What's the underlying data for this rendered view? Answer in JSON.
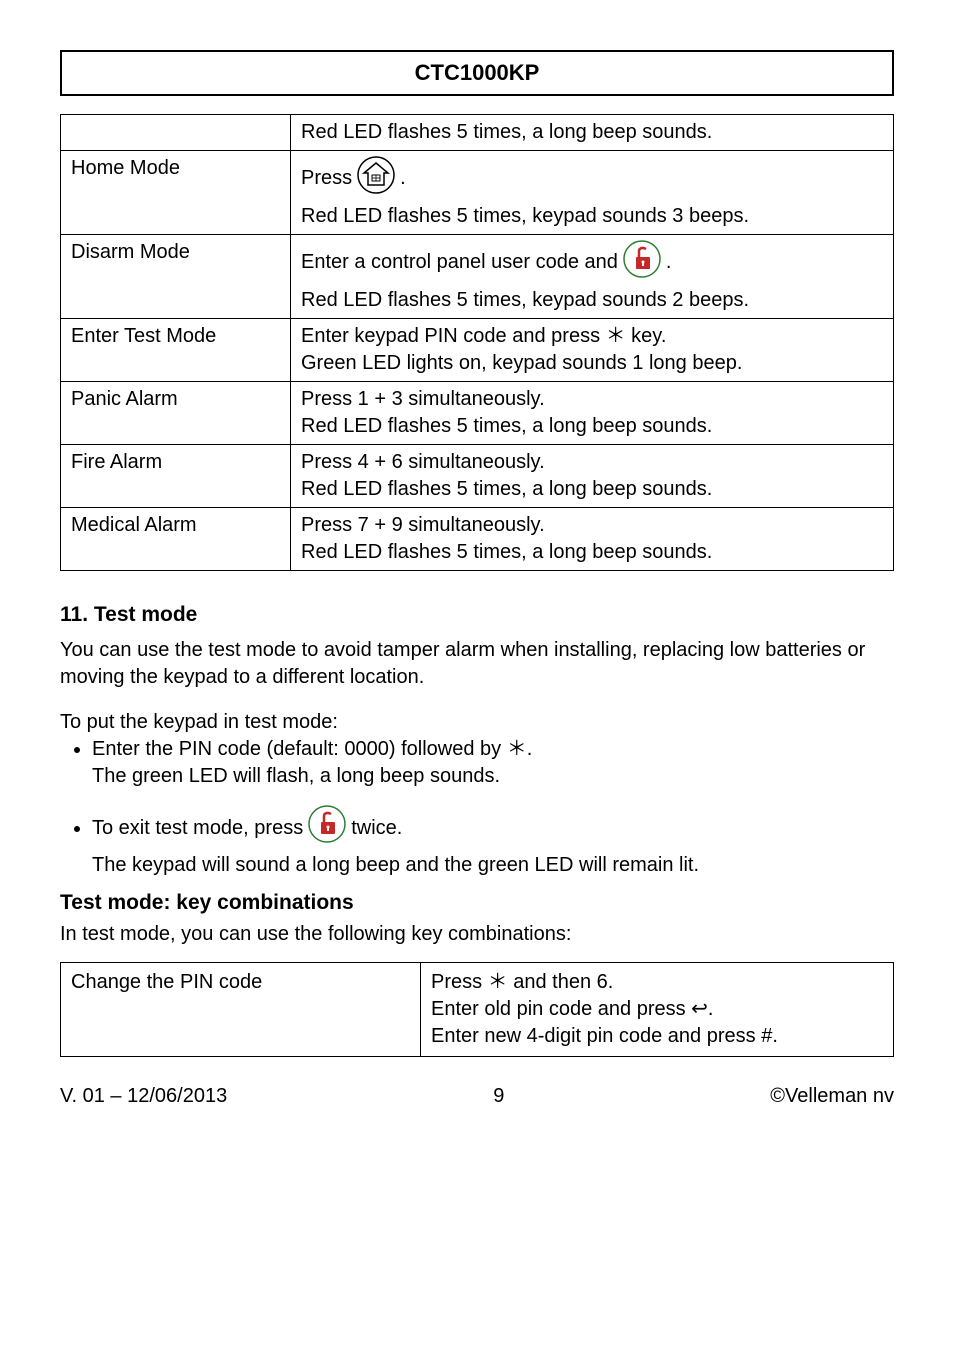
{
  "header": {
    "title": "CTC1000KP"
  },
  "table1": {
    "row_top": "Red LED flashes 5 times, a long beep sounds.",
    "home_mode": {
      "label": "Home Mode",
      "press_prefix": "Press",
      "press_suffix": ".",
      "line2": "Red LED flashes 5 times, keypad sounds 3 beeps."
    },
    "disarm_mode": {
      "label": "Disarm Mode",
      "line1_prefix": "Enter a control panel user code and",
      "line1_suffix": ".",
      "line2": "Red LED flashes 5 times, keypad sounds 2 beeps."
    },
    "enter_test": {
      "label": "Enter Test Mode",
      "line1": "Enter keypad PIN code and press ＊ key.",
      "line2": "Green LED lights on, keypad sounds 1 long beep."
    },
    "panic": {
      "label": "Panic Alarm",
      "line1": "Press 1 + 3 simultaneously.",
      "line2": "Red LED flashes 5 times, a long beep sounds."
    },
    "fire": {
      "label": "Fire Alarm",
      "line1": "Press 4 + 6 simultaneously.",
      "line2": "Red LED flashes 5 times, a long beep sounds."
    },
    "medical": {
      "label": "Medical Alarm",
      "line1": "Press 7 + 9 simultaneously.",
      "line2": "Red LED flashes 5 times, a long beep sounds."
    }
  },
  "section11": {
    "heading": "11. Test mode",
    "para1": "You can use the test mode to avoid tamper alarm when installing, replacing low batteries or moving the keypad to a different location.",
    "intro": "To put the keypad in test mode:",
    "bullet1_line1": "Enter the PIN code (default: 0000) followed by ＊.",
    "bullet1_line2": "The green LED will flash, a long beep sounds.",
    "bullet2_prefix": "To exit test mode, press",
    "bullet2_suffix": "twice.",
    "bullet2_line2": "The keypad will sound a long beep and the green LED will remain lit."
  },
  "sub": {
    "heading": "Test mode: key combinations",
    "intro": "In test mode, you can use the following key combinations:"
  },
  "table2": {
    "change_pin": {
      "label": "Change the PIN code",
      "l1": "Press ＊ and then 6.",
      "l2": "Enter old pin code and press ↩.",
      "l3": "Enter new 4-digit pin code and press #."
    }
  },
  "footer": {
    "version": "V. 01 – 12/06/2013",
    "page": "9",
    "copyright": "©Velleman nv"
  }
}
